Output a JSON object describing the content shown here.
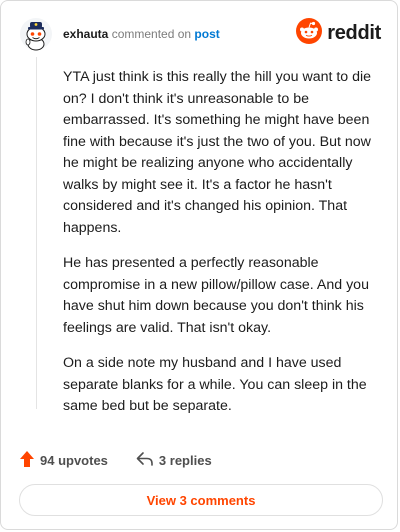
{
  "comment": {
    "username": "exhauta",
    "commented_on_text": " commented on ",
    "post_link": "post",
    "paragraphs": [
      "YTA just think is this really the hill you want to die on? I don't think it's unreasonable to be embarrassed. It's something he might have been fine with because it's just the two of you. But now he might be realizing anyone who accidentally walks by might see it. It's a factor he hasn't considered and it's changed his opinion. That happens.",
      "He has presented a perfectly reasonable compromise in a new pillow/pillow case. And you have shut him down because you don't think his feelings are valid. That isn't okay.",
      "On a side note my husband and I have used separate blanks for a while. You can sleep in the same bed but be separate."
    ],
    "upvotes": "94 upvotes",
    "replies": "3 replies",
    "view_comments": "View 3 comments"
  },
  "brand": {
    "wordmark": "reddit",
    "accent": "#ff4500"
  },
  "icons": {
    "avatar": "snoo-avatar-icon",
    "logo": "reddit-snoo-icon",
    "upvote": "upvote-arrow-icon",
    "reply": "reply-arrow-icon"
  }
}
